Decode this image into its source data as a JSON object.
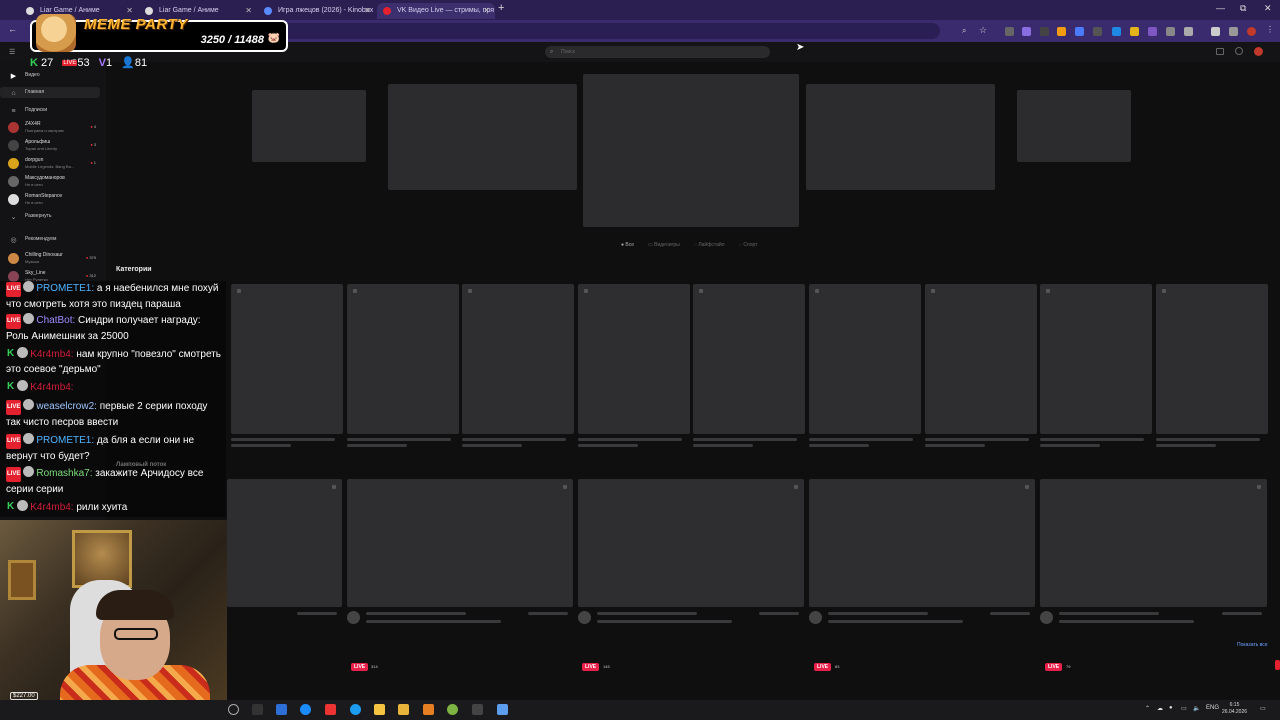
{
  "browser": {
    "tabs": [
      {
        "label": "Liar Game / Аниме",
        "active": false
      },
      {
        "label": "Liar Game / Аниме",
        "active": false
      },
      {
        "label": "Игра лжецов (2026) - Kinobox",
        "active": false
      },
      {
        "label": "VK Видео Live — стримы, пря",
        "active": true
      }
    ],
    "new_tab": "+",
    "window_controls": [
      "—",
      "⧉",
      "✕"
    ]
  },
  "overlay": {
    "meme_title": "MEME PARTY",
    "meme_score": "3250 / 11488",
    "stats": [
      {
        "icon": "kick-icon",
        "value": "27"
      },
      {
        "icon": "live-icon",
        "value": "53"
      },
      {
        "icon": "vk-icon",
        "value": "1"
      },
      {
        "icon": "viewers-icon",
        "value": "81"
      }
    ]
  },
  "header": {
    "search_placeholder": "Поиск"
  },
  "sidebar": {
    "video_label": "Видео",
    "items": [
      {
        "label": "Главная",
        "icon": "home-icon"
      },
      {
        "label": "Подписки",
        "icon": "subscriptions-icon"
      }
    ],
    "channels": [
      {
        "name": "Z4X4R",
        "sub": "Поиграем и смотрим",
        "count": "4",
        "color": "#a33"
      },
      {
        "name": "Арольфиш",
        "sub": "Тиран and Liberty",
        "count": "3",
        "color": "#444"
      },
      {
        "name": "dorpgun",
        "sub": "Mobile Legends: Bang Ba...",
        "count": "1",
        "color": "#d9a21b"
      },
      {
        "name": "Максудоманоров",
        "sub": "Не в сети",
        "count": "",
        "color": "#666"
      },
      {
        "name": "RomanStepanov",
        "sub": "Не в сети",
        "count": "",
        "color": "#ddd"
      }
    ],
    "expand_label": "Развернуть",
    "recommended_label": "Рекомендуем",
    "recommended": [
      {
        "name": "Chilling Dinosaur",
        "sub": "Музыка",
        "count": "379",
        "color": "#c84"
      },
      {
        "name": "Sky_Line",
        "sub": "Нет Рулетки",
        "count": "312",
        "color": "#845"
      }
    ]
  },
  "main": {
    "filters": [
      "Все",
      "Видеоигры",
      "Лайфстайл",
      "Спорт"
    ],
    "categories_title": "Категории",
    "streams_title": "Ламповый поток",
    "show_all": "Показать все",
    "live_label": "LIVE",
    "live_counts": [
      "314",
      "145",
      "83",
      "79"
    ]
  },
  "chat": {
    "messages": [
      {
        "platform": "live",
        "nick": "PROMETE1:",
        "nick_color": "#4fb3ff",
        "text": " а я наебенился мне похуй что смотреть хотя это пиздец параша"
      },
      {
        "platform": "live",
        "nick": "ChatBot:",
        "nick_color": "#9d8cff",
        "text": " Синдри получает награду: Роль Анимешник за 25000",
        "bold_start": "Синдри"
      },
      {
        "platform": "k",
        "nick": "K4r4mb4:",
        "nick_color": "#d21c3a",
        "text": " нам крупно \"повезло\" смотреть это соевое \"дерьмо\""
      },
      {
        "platform": "k",
        "nick": "K4r4mb4:",
        "nick_color": "#d21c3a",
        "text": ""
      },
      {
        "platform": "live",
        "nick": "weaselcrow2:",
        "nick_color": "#9dc6ff",
        "text": " первые 2 серии походу так чисто песров ввести"
      },
      {
        "platform": "live",
        "nick": "PROMETE1:",
        "nick_color": "#4fb3ff",
        "text": " да бля а если они не вернут что будет?"
      },
      {
        "platform": "live",
        "nick": "Romashka7:",
        "nick_color": "#7ddc7d",
        "text": " закажите Арчидосу все серии серии"
      },
      {
        "platform": "k",
        "nick": "K4r4mb4:",
        "nick_color": "#d21c3a",
        "text": " рили хуита"
      }
    ]
  },
  "webcam": {
    "label": "$227.00"
  },
  "taskbar": {
    "tray_lang": "ENG",
    "time": "6:15",
    "date": "26.04.2026"
  }
}
